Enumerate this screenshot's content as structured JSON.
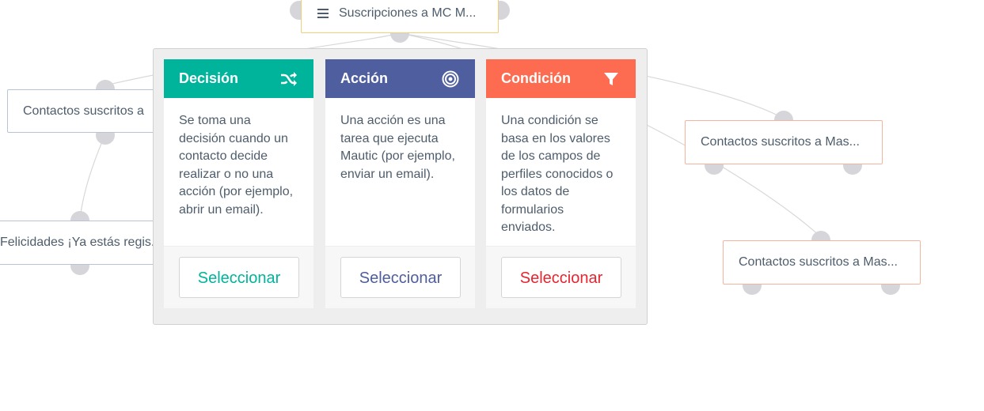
{
  "canvas": {
    "source_node": {
      "label": "Suscripciones a MC M..."
    },
    "nodes": [
      {
        "label": "Contactos suscritos a"
      },
      {
        "label": "Felicidades ¡Ya estás regis..."
      },
      {
        "label": "Contactos suscritos a Mas..."
      },
      {
        "label": "Contactos suscritos a Mas..."
      }
    ]
  },
  "picker": {
    "cards": [
      {
        "title": "Decisión",
        "description": "Se toma una decisión cuando un contacto decide realizar o no una acción (por ejemplo, abrir un email).",
        "button": "Seleccionar",
        "icon": "shuffle-icon",
        "color": "#00b49c",
        "button_color": "#00b49c"
      },
      {
        "title": "Acción",
        "description": "Una acción es una tarea que ejecuta Mautic (por ejemplo, enviar un email).",
        "button": "Seleccionar",
        "icon": "bullseye-icon",
        "color": "#4e5e9e",
        "button_color": "#4e5e9e"
      },
      {
        "title": "Condición",
        "description": "Una condición se basa en los valores de los campos de perfiles conocidos o los datos de formularios enviados.",
        "button": "Seleccionar",
        "icon": "filter-icon",
        "color": "#fd6c50",
        "button_color": "#e5252f"
      }
    ]
  }
}
